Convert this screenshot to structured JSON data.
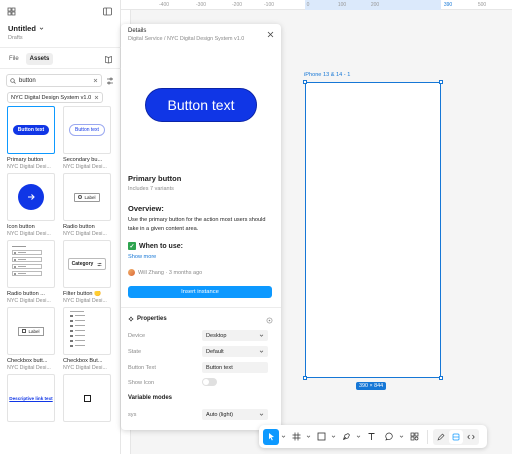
{
  "sidebar": {
    "file_title": "Untitled",
    "file_sub": "Drafts",
    "tabs": [
      "File",
      "Assets"
    ],
    "search_value": "button",
    "library": "NYC Digital Design System v1.0",
    "components": [
      {
        "name": "Primary button",
        "lib": "NYC Digital Desi...",
        "thumb_text": "Button text"
      },
      {
        "name": "Secondary bu...",
        "lib": "NYC Digital Desi...",
        "thumb_text": "Button text"
      },
      {
        "name": "Icon button",
        "lib": "NYC Digital Desi..."
      },
      {
        "name": "Radio button",
        "lib": "NYC Digital Desi...",
        "thumb_text": "Label"
      },
      {
        "name": "Radio button ...",
        "lib": "NYC Digital Desi..."
      },
      {
        "name": "Filter button 🟡",
        "lib": "NYC Digital Desi...",
        "thumb_text": "Category"
      },
      {
        "name": "Checkbox butt...",
        "lib": "NYC Digital Desi...",
        "thumb_text": "Label"
      },
      {
        "name": "Checkbox But...",
        "lib": "NYC Digital Desi..."
      },
      {
        "name": "",
        "lib": "",
        "thumb_text": "Descriptive link text"
      },
      {
        "name": "",
        "lib": ""
      }
    ]
  },
  "ruler": {
    "ticks": [
      "-400",
      "-300",
      "-200",
      "-100",
      "0",
      "100",
      "200",
      "390",
      "500"
    ]
  },
  "canvas": {
    "frame_label": "iPhone 13 & 14 - 1",
    "frame_size": "390 × 844"
  },
  "details": {
    "header": "Details",
    "path": "Digital Service / NYC Digital Design System v1.0",
    "preview_button": "Button text",
    "title": "Primary button",
    "variants": "Includes 7 variants",
    "overview_heading": "Overview:",
    "overview_text": "Use the primary button for the action most users should take in a given content area.",
    "when_heading": "When to use:",
    "show_more": "Show more",
    "author": "Will Zhang · 3 months ago",
    "insert_label": "Insert instance",
    "properties_heading": "Properties",
    "props": [
      {
        "label": "Device",
        "value": "Desktop"
      },
      {
        "label": "State",
        "value": "Default"
      },
      {
        "label": "Button Text",
        "value": "Button text"
      },
      {
        "label": "Show Icon",
        "value": ""
      }
    ],
    "variable_modes_heading": "Variable modes",
    "variable_modes": [
      {
        "label": "sys",
        "value": "Auto (light)"
      }
    ]
  },
  "colors": {
    "brand_blue": "#1036e6",
    "figma_blue": "#0d99ff",
    "selection_blue": "#1677d6"
  }
}
